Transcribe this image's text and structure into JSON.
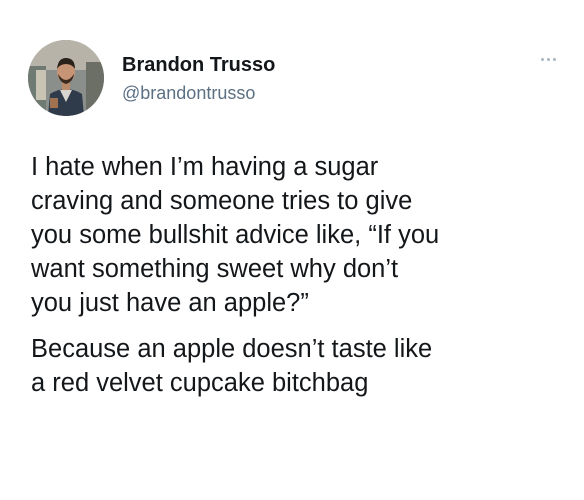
{
  "author": {
    "display_name": "Brandon Trusso",
    "handle": "@brandontrusso"
  },
  "icons": {
    "avatar": "profile-photo",
    "more": "more-options-icon"
  },
  "tweet": {
    "paragraphs": [
      "I hate when I’m having a sugar\ncraving and someone tries to give\nyou some bullshit advice like, “If you\nwant something sweet why don’t\nyou just have an apple?”",
      "Because an apple doesn’t taste like\na red velvet cupcake bitchbag"
    ]
  }
}
